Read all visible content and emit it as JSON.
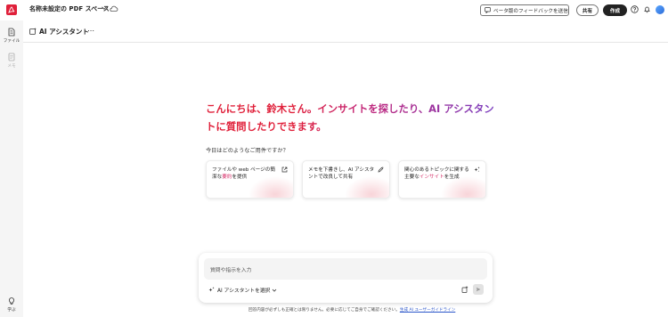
{
  "topbar": {
    "space_title": "名称未設定の PDF スペース",
    "feedback_label": "ベータ版のフィードバックを送信",
    "share_label": "共有",
    "create_label": "作成"
  },
  "sidebar": {
    "items": [
      {
        "label": "ファイル",
        "icon": "files-icon"
      },
      {
        "label": "メモ",
        "icon": "notes-icon"
      },
      {
        "label": "学ぶ",
        "icon": "learn-icon"
      }
    ]
  },
  "panel": {
    "title": "AI アシスタント"
  },
  "greeting": "こんにちは、鈴木さん。インサイトを探したり、AI アシスタントに質問したりできます。",
  "prompt_label": "今日はどのようなご用件ですか？",
  "cards": [
    {
      "pre": "ファイルや web ページの簡潔な",
      "highlight": "要約",
      "post": "を提供",
      "icon": "open-external-icon"
    },
    {
      "pre": "メモを下書きし、AI アシスタントで改良して共有",
      "highlight": "",
      "post": "",
      "icon": "edit-note-icon"
    },
    {
      "pre": "関心のあるトピックに関する主要な",
      "highlight": "インサイト",
      "post": "を生成",
      "icon": "sparkle-icon"
    }
  ],
  "input": {
    "placeholder": "質問や指示を入力",
    "assistant_select_label": "AI アシスタントを選択"
  },
  "footer": {
    "text": "回答内容が必ずしも正確とは限りません。必要に応じてご自身でご確認ください。",
    "link": "生成 AI ユーザーガイドライン"
  },
  "colors": {
    "brand_red": "#e0203a",
    "accent_purple": "#7a3fc0",
    "create_button": "#222222"
  }
}
